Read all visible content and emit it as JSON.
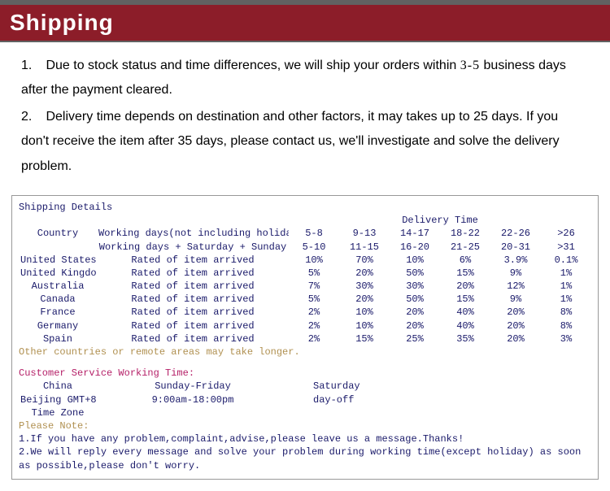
{
  "header": {
    "title": "Shipping"
  },
  "intro": {
    "para1_a": "1.",
    "para1_b": "Due to stock status and time differences, we will ship your orders within",
    "para1_c": "3-5",
    "para1_d": "business days after the payment cleared.",
    "para2_a": "2.",
    "para2_b": "Delivery time depends on destination and other factors, it may takes up to 25 days. If you don't receive the item after 35 days, please contact us, we'll investigate and solve the delivery problem."
  },
  "details": {
    "title": "Shipping Details",
    "delivery_time_label": "Delivery Time",
    "country_label": "Country",
    "workdays_label": "Working days(not including holiday)",
    "fulldays_label": "Working days + Saturday + Sunday",
    "work_ranges": [
      "5-8",
      "9-13",
      "14-17",
      "18-22",
      "22-26",
      ">26"
    ],
    "full_ranges": [
      "5-10",
      "11-15",
      "16-20",
      "21-25",
      "20-31",
      ">31"
    ],
    "rate_label": "Rated of item arrived",
    "rows": [
      {
        "country": "United States",
        "rates": [
          "10%",
          "70%",
          "10%",
          "6%",
          "3.9%",
          "0.1%"
        ]
      },
      {
        "country": "United Kingdom",
        "rates": [
          "5%",
          "20%",
          "50%",
          "15%",
          "9%",
          "1%"
        ]
      },
      {
        "country": "Australia",
        "rates": [
          "7%",
          "30%",
          "30%",
          "20%",
          "12%",
          "1%"
        ]
      },
      {
        "country": "Canada",
        "rates": [
          "5%",
          "20%",
          "50%",
          "15%",
          "9%",
          "1%"
        ]
      },
      {
        "country": "France",
        "rates": [
          "2%",
          "10%",
          "20%",
          "40%",
          "20%",
          "8%"
        ]
      },
      {
        "country": "Germany",
        "rates": [
          "2%",
          "10%",
          "20%",
          "40%",
          "20%",
          "8%"
        ]
      },
      {
        "country": "Spain",
        "rates": [
          "2%",
          "15%",
          "25%",
          "35%",
          "20%",
          "3%"
        ]
      }
    ],
    "other_note": "Other countries or remote areas may take longer.",
    "cs_title": "Customer Service Working Time:",
    "cs_col1": "China",
    "cs_col2": "Sunday-Friday",
    "cs_col3": "Saturday",
    "cs_col1b": "Beijing GMT+8",
    "cs_col1c": "Time Zone",
    "cs_col2b": "9:00am-18:00pm",
    "cs_col3b": "day-off",
    "please_note": "Please Note:",
    "note1": "1.If you have any problem,complaint,advise,please leave us a message.Thanks!",
    "note2": "2.We will reply every message and solve your problem during working time(except holiday) as soon as possible,please don't worry."
  }
}
